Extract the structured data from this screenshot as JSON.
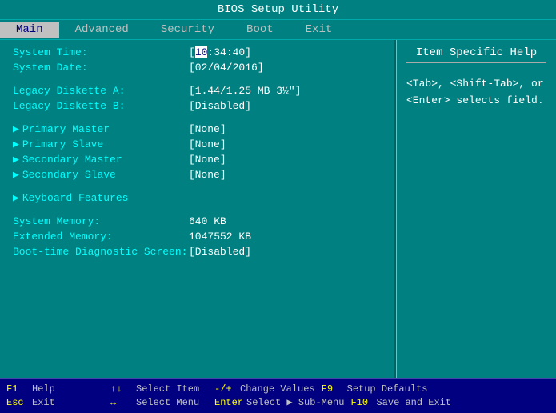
{
  "title": "BIOS Setup Utility",
  "menu": {
    "items": [
      {
        "label": "Main",
        "active": true
      },
      {
        "label": "Advanced",
        "active": false
      },
      {
        "label": "Security",
        "active": false
      },
      {
        "label": "Boot",
        "active": false
      },
      {
        "label": "Exit",
        "active": false
      }
    ]
  },
  "help_panel": {
    "title": "Item Specific Help",
    "text": "<Tab>, <Shift-Tab>, or\n<Enter> selects field."
  },
  "fields": {
    "system_time_label": "System Time:",
    "system_time_value_prefix": "[",
    "system_time_cursor": "10",
    "system_time_value_suffix": ":34:40]",
    "system_date_label": "System Date:",
    "system_date_value": "[02/04/2016]",
    "legacy_a_label": "Legacy Diskette A:",
    "legacy_a_value": "[1.44/1.25 MB  3½\"]",
    "legacy_b_label": "Legacy Diskette B:",
    "legacy_b_value": "[Disabled]",
    "primary_master_label": "Primary Master",
    "primary_master_value": "[None]",
    "primary_slave_label": "Primary Slave",
    "primary_slave_value": "[None]",
    "secondary_master_label": "Secondary Master",
    "secondary_master_value": "[None]",
    "secondary_slave_label": "Secondary Slave",
    "secondary_slave_value": "[None]",
    "keyboard_features_label": "Keyboard Features",
    "system_memory_label": "System Memory:",
    "system_memory_value": "640 KB",
    "extended_memory_label": "Extended Memory:",
    "extended_memory_value": "1047552 KB",
    "boot_diag_label": "Boot-time Diagnostic Screen:",
    "boot_diag_value": "[Disabled]"
  },
  "status_bar": {
    "f1_key": "F1",
    "f1_desc": "Help",
    "updown_key": "↑↓",
    "updown_desc": "Select Item",
    "dash_plus_key": "-/+",
    "dash_plus_desc": "Change Values",
    "f9_key": "F9",
    "f9_desc": "Setup Defaults",
    "esc_key": "Esc",
    "esc_desc": "Exit",
    "leftright_key": "↔",
    "leftright_desc": "Select Menu",
    "enter_key": "Enter",
    "enter_desc": "Select ▶ Sub-Menu",
    "f10_key": "F10",
    "f10_desc": "Save and Exit"
  }
}
